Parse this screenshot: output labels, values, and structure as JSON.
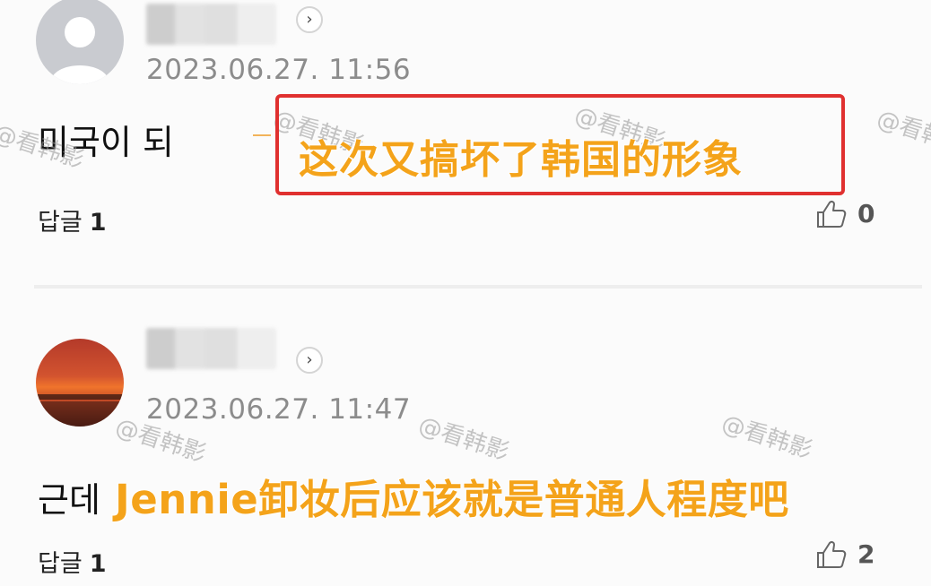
{
  "comments": [
    {
      "date": "2023.06.27. 11:56",
      "text": "미국이 되",
      "reply_label": "답글",
      "reply_count": "1",
      "like_count": "0",
      "chevron": "›"
    },
    {
      "date": "2023.06.27. 11:47",
      "text": "근데",
      "reply_label": "답글",
      "reply_count": "1",
      "like_count": "2",
      "chevron": "›"
    }
  ],
  "captions": [
    "这次又搞坏了韩国的形象",
    "Jennie卸妆后应该就是普通人程度吧"
  ],
  "watermark": "@看韩影",
  "colors": {
    "caption": "#f4a31a",
    "caption_box": "#e0302f",
    "date": "#8c8c8c"
  },
  "icons": [
    "default-avatar-icon",
    "chevron-right-icon",
    "thumbs-up-icon"
  ]
}
